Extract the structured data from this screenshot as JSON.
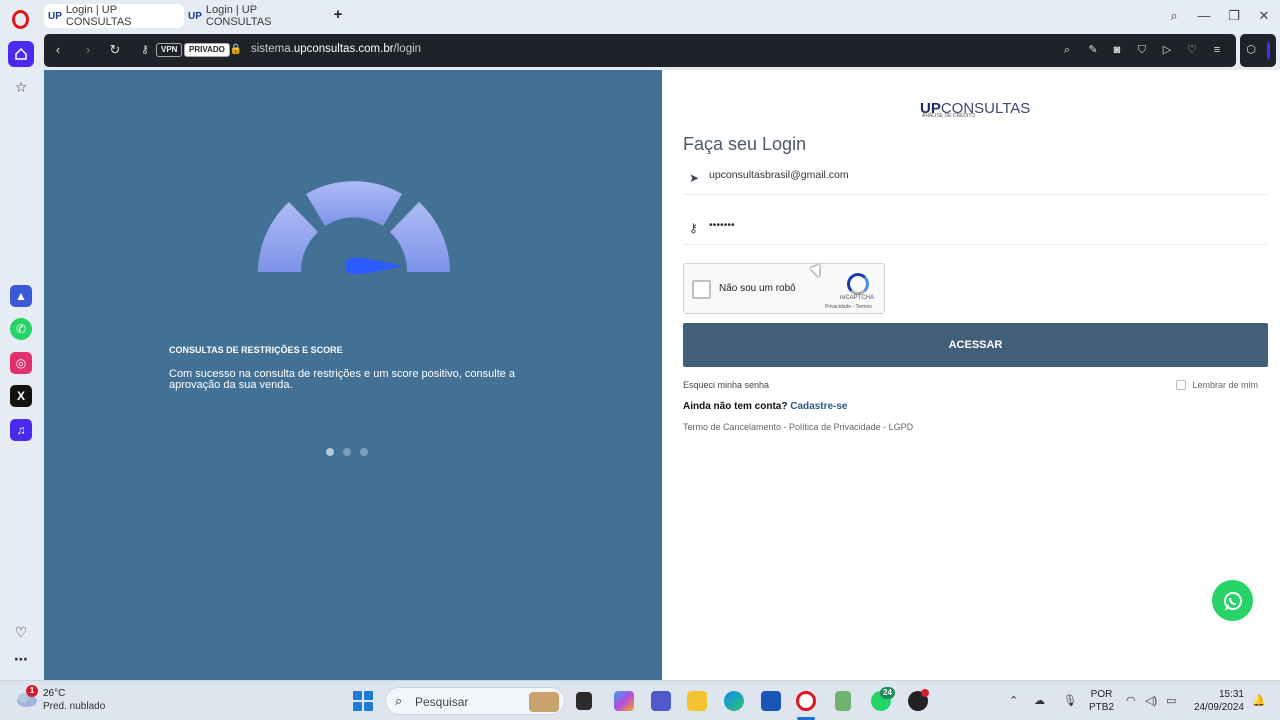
{
  "browser": {
    "tabs": [
      {
        "favicon": "UP",
        "title": "Login | UP CONSULTAS",
        "active": true
      },
      {
        "favicon": "UP",
        "title": "Login | UP CONSULTAS",
        "active": false
      }
    ],
    "address": {
      "vpn_label": "VPN",
      "private_label": "PRIVADO",
      "url_prefix": "sistema.",
      "url_domain": "upconsultas.com.br",
      "url_path": "/login"
    }
  },
  "hero": {
    "title": "CONSULTAS DE RESTRIÇÕES E SCORE",
    "text": "Com sucesso na consulta de restrições e um score positivo, consulte a aprovação da sua venda.",
    "gauge_colors": [
      "#a6b6f2",
      "#7d93ea"
    ],
    "slide_count": 3,
    "active_slide": 1
  },
  "login": {
    "logo_bold": "UP",
    "logo_rest": "CONSULTAS",
    "logo_sub": "ANÁLISE DE CRÉDITO",
    "title": "Faça seu Login",
    "email_value": "upconsultasbrasil@gmail.com",
    "password_value": "•••••••",
    "captcha_label": "Não sou um robô",
    "captcha_brand": "reCAPTCHA",
    "captcha_links": "Privacidade - Termos",
    "submit_label": "ACESSAR",
    "forgot_label": "Esqueci minha senha",
    "remember_label": "Lembrar de mim",
    "signup_question": "Ainda não tem conta?",
    "signup_link": "Cadastre-se",
    "legal_links": "Termo de Cancelamento - Política de Privacidade - LGPD",
    "button_color": "#415f79",
    "hero_color": "#437196"
  },
  "taskbar": {
    "weather_badge": "1",
    "temperature": "26°C",
    "condition": "Pred. nublado",
    "search_placeholder": "Pesquisar",
    "whatsapp_badge": "24",
    "lang_top": "POR",
    "lang_bottom": "PTB2",
    "time": "15:31",
    "date": "24/09/2024"
  }
}
